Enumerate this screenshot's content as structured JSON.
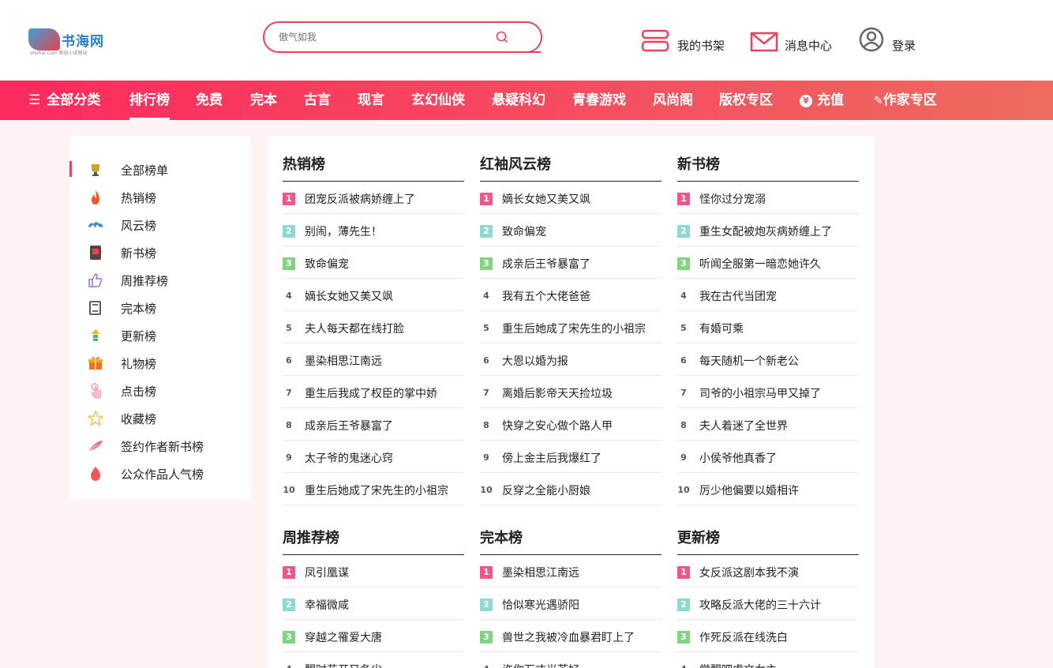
{
  "header": {
    "logo_name": "书海网",
    "logo_sub": "shuhai.com 原创小说网站",
    "search_placeholder": "傲气如我",
    "shelf_label": "我的书架",
    "msg_label": "消息中心",
    "login_label": "登录"
  },
  "nav": {
    "items": [
      "全部分类",
      "排行榜",
      "免费",
      "完本",
      "古言",
      "现言",
      "玄幻仙侠",
      "悬疑科幻",
      "青春游戏",
      "风尚阁",
      "版权专区",
      "充值",
      "作家专区"
    ],
    "active_index": 1
  },
  "sidebar": {
    "items": [
      "全部榜单",
      "热销榜",
      "风云榜",
      "新书榜",
      "周推荐榜",
      "完本榜",
      "更新榜",
      "礼物榜",
      "点击榜",
      "收藏榜",
      "签约作者新书榜",
      "公众作品人气榜"
    ],
    "icons": [
      "trophy-icon",
      "flame-icon",
      "cloud-icon",
      "book-icon",
      "thumbs-up-icon",
      "open-book-icon",
      "arrow-up-icon",
      "gift-icon",
      "pointer-icon",
      "star-icon",
      "feather-icon",
      "fire-drop-icon"
    ]
  },
  "lists": [
    {
      "title": "热销榜",
      "items": [
        "团宠反派被病娇缠上了",
        "别闹，薄先生！",
        "致命偏宠",
        "嫡长女她又美又飒",
        "夫人每天都在线打脸",
        "墨染相思江南远",
        "重生后我成了权臣的掌中娇",
        "成亲后王爷暴富了",
        "太子爷的鬼迷心窍",
        "重生后她成了宋先生的小祖宗"
      ]
    },
    {
      "title": "红袖风云榜",
      "items": [
        "嫡长女她又美又飒",
        "致命偏宠",
        "成亲后王爷暴富了",
        "我有五个大佬爸爸",
        "重生后她成了宋先生的小祖宗",
        "大恩以婚为报",
        "离婚后影帝天天捡垃圾",
        "快穿之安心做个路人甲",
        "傍上金主后我爆红了",
        "反穿之全能小厨娘"
      ]
    },
    {
      "title": "新书榜",
      "items": [
        "怪你过分宠溺",
        "重生女配被炮灰病娇缠上了",
        "听闻全服第一暗恋她许久",
        "我在古代当团宠",
        "有婚可乘",
        "每天随机一个新老公",
        "司爷的小祖宗马甲又掉了",
        "夫人着迷了全世界",
        "小侯爷他真香了",
        "厉少他偏要以婚相许"
      ]
    },
    {
      "title": "周推荐榜",
      "items": [
        "凤引凰谋",
        "幸福微咸",
        "穿越之罹爱大唐",
        "醒时花开又冬尘"
      ]
    },
    {
      "title": "完本榜",
      "items": [
        "墨染相思江南远",
        "恰似寒光遇骄阳",
        "兽世之我被冷血暴君盯上了",
        "许你万丈光芒好"
      ]
    },
    {
      "title": "更新榜",
      "items": [
        "女反派这剧本我不演",
        "攻略反派大佬的三十六计",
        "作死反派在线洗白",
        "觉醒吧虐文女主"
      ]
    }
  ],
  "colors": {
    "accent": "#e8435a",
    "rank1": "#f4568c",
    "rank2": "#8fd9d3",
    "rank3": "#82d483"
  }
}
